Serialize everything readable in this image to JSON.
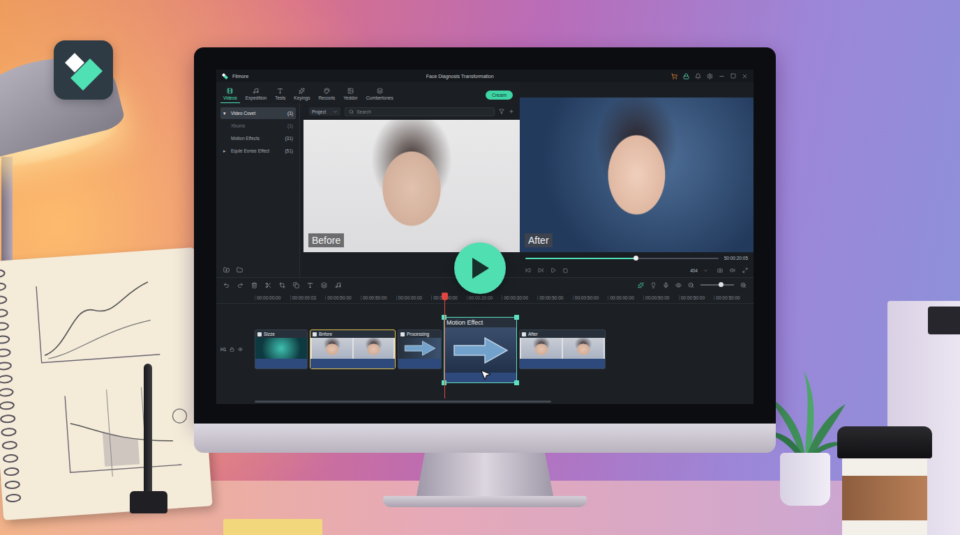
{
  "window": {
    "app": "Filmore",
    "title": "Face Diagnosis Transformation"
  },
  "tabs": [
    {
      "label": "Videos",
      "selected": true
    },
    {
      "label": "Expedition",
      "selected": false
    },
    {
      "label": "Tests",
      "selected": false
    },
    {
      "label": "Keyings",
      "selected": false
    },
    {
      "label": "Recoots",
      "selected": false
    },
    {
      "label": "Yeddor",
      "selected": false
    },
    {
      "label": "Cumbertones",
      "selected": false
    }
  ],
  "createButton": "Cream",
  "sidebar": {
    "items": [
      {
        "label": "Video Covet",
        "count": "(1)",
        "selected": true,
        "disabled": false,
        "expander": "▾"
      },
      {
        "label": "Xbums",
        "count": "(1)",
        "selected": false,
        "disabled": true
      },
      {
        "label": "Motion Effects",
        "count": "(31)",
        "selected": false,
        "disabled": false
      },
      {
        "label": "Equle Eonse Effect",
        "count": "(51)",
        "selected": false,
        "disabled": false,
        "expander": "▸"
      }
    ]
  },
  "search": {
    "scope": "Project",
    "placeholder": "Search"
  },
  "preview": {
    "before": "Before",
    "after": "After",
    "timecode": "50:00:20:05",
    "level": 0.57,
    "quality": "404"
  },
  "timeline": {
    "track": "H1",
    "playhead": 0.384,
    "ruler": [
      "00:00:00:00",
      "00:00:00:03",
      "00:00:50:00",
      "00:00:50:00",
      "00:00:00:00",
      "00:00:00:00",
      "00:00:20:00",
      "00:00:30:00",
      "00:00:50:00",
      "00:00:50:00",
      "00:00:00:00",
      "00:00:50:00",
      "00:00:50:00",
      "00:00:50:00"
    ],
    "clips": [
      {
        "label": "Sizze",
        "kind": "scan",
        "selected": false,
        "outlined": false
      },
      {
        "label": "Bnfore",
        "kind": "faces",
        "selected": false,
        "outlined": true
      },
      {
        "label": "Processing",
        "kind": "transition",
        "selected": false,
        "outlined": false
      },
      {
        "label": "Motion Effect",
        "kind": "effect",
        "selected": true,
        "outlined": false
      },
      {
        "label": "After",
        "kind": "faces",
        "selected": false,
        "outlined": false
      }
    ]
  }
}
